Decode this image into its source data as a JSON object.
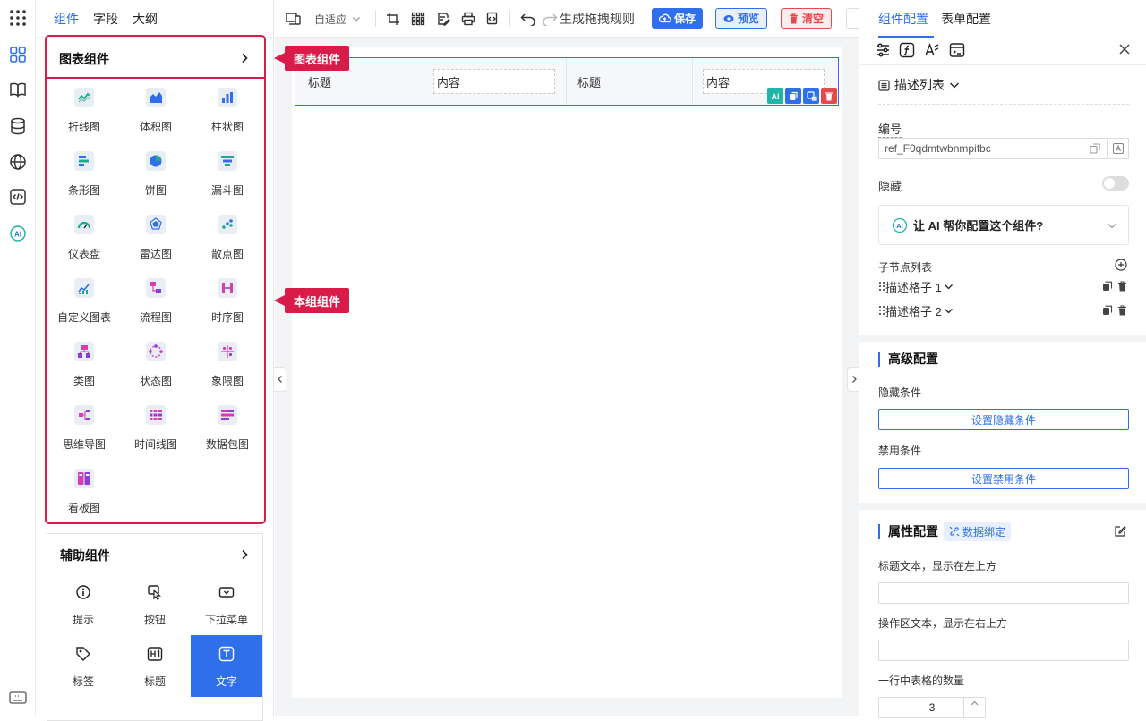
{
  "left_tabs": [
    "组件",
    "字段",
    "大纲"
  ],
  "chart_section": {
    "title": "图表组件",
    "items": [
      {
        "label": "折线图",
        "icon": "line-chart-icon",
        "color": "#1faa8c"
      },
      {
        "label": "体积图",
        "icon": "area-chart-icon",
        "color": "#2f6feb"
      },
      {
        "label": "柱状图",
        "icon": "bar-chart-icon",
        "color": "#2f6feb"
      },
      {
        "label": "条形图",
        "icon": "horizontal-bar-icon",
        "color": "#2f6feb"
      },
      {
        "label": "饼图",
        "icon": "pie-chart-icon",
        "color": "#2f6feb"
      },
      {
        "label": "漏斗图",
        "icon": "funnel-chart-icon",
        "color": "#1faa8c"
      },
      {
        "label": "仪表盘",
        "icon": "gauge-icon",
        "color": "#1faa8c"
      },
      {
        "label": "雷达图",
        "icon": "radar-chart-icon",
        "color": "#2f6feb"
      },
      {
        "label": "散点图",
        "icon": "scatter-chart-icon",
        "color": "#1faa8c"
      },
      {
        "label": "自定义图表",
        "icon": "custom-chart-icon",
        "color": "#2f6feb"
      },
      {
        "label": "流程图",
        "icon": "flowchart-icon",
        "color": "#d63fb0"
      },
      {
        "label": "时序图",
        "icon": "sequence-diagram-icon",
        "color": "#d63fb0"
      },
      {
        "label": "类图",
        "icon": "class-diagram-icon",
        "color": "#d63fb0"
      },
      {
        "label": "状态图",
        "icon": "state-diagram-icon",
        "color": "#d63fb0"
      },
      {
        "label": "象限图",
        "icon": "quadrant-chart-icon",
        "color": "#d63fb0"
      },
      {
        "label": "思维导图",
        "icon": "mindmap-icon",
        "color": "#d63fb0"
      },
      {
        "label": "时间线图",
        "icon": "timeline-icon",
        "color": "#d63fb0"
      },
      {
        "label": "数据包图",
        "icon": "packet-diagram-icon",
        "color": "#d63fb0"
      },
      {
        "label": "看板图",
        "icon": "kanban-icon",
        "color": "#d63fb0"
      }
    ]
  },
  "aux_section": {
    "title": "辅助组件",
    "items": [
      {
        "label": "提示",
        "icon": "info-icon"
      },
      {
        "label": "按钮",
        "icon": "click-icon"
      },
      {
        "label": "下拉菜单",
        "icon": "dropdown-icon"
      },
      {
        "label": "标签",
        "icon": "tag-icon"
      },
      {
        "label": "标题",
        "icon": "heading-icon"
      },
      {
        "label": "文字",
        "icon": "text-icon"
      }
    ]
  },
  "callouts": {
    "chart": "图表组件",
    "group": "本组组件"
  },
  "toolbar": {
    "mode": "自适应",
    "generate": "生成拖拽规则",
    "save": "保存",
    "preview": "预览",
    "clear": "清空"
  },
  "canvas": {
    "cells": [
      {
        "label": "标题",
        "value": "内容"
      },
      {
        "label": "标题",
        "value": "内容"
      }
    ]
  },
  "right": {
    "tabs": [
      "组件配置",
      "表单配置"
    ],
    "component_type": "描述列表",
    "id_label": "编号",
    "id_value": "ref_F0qdmtwbnmpifbc",
    "hidden_label": "隐藏",
    "ai_prompt": "让 AI 帮你配置这个组件?",
    "children_label": "子节点列表",
    "children": [
      "描述格子 1",
      "描述格子 2"
    ],
    "advanced_title": "高级配置",
    "hide_cond_label": "隐藏条件",
    "hide_cond_btn": "设置隐藏条件",
    "disable_cond_label": "禁用条件",
    "disable_cond_btn": "设置禁用条件",
    "prop_title": "属性配置",
    "data_binding": "数据绑定",
    "title_text_label": "标题文本，显示在左上方",
    "action_text_label": "操作区文本，显示在右上方",
    "count_label": "一行中表格的数量",
    "count_value": "3"
  },
  "colors": {
    "accent": "#2f6feb",
    "danger": "#e5484d",
    "callout": "#d81b48"
  }
}
